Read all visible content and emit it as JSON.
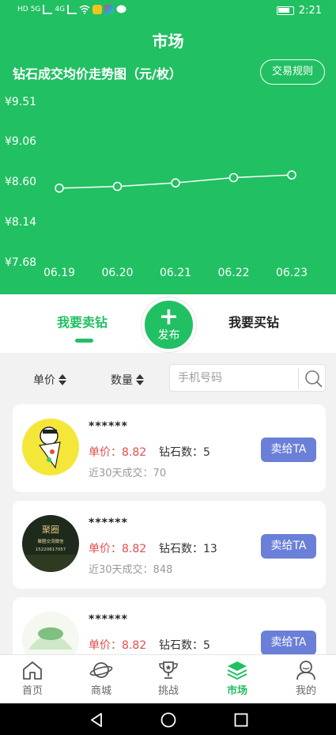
{
  "status_bar": {
    "time": "2:21",
    "left_labels": [
      "HD",
      "5G",
      "4G"
    ]
  },
  "header": {
    "title": "市场",
    "chart_title": "钻石成交均价走势图（元/枚）",
    "rules_button": "交易规则"
  },
  "chart_data": {
    "type": "line",
    "title": "钻石成交均价走势图（元/枚）",
    "categories": [
      "06.19",
      "06.20",
      "06.21",
      "06.22",
      "06.23"
    ],
    "series": [
      {
        "values": [
          8.52,
          8.54,
          8.58,
          8.64,
          8.67
        ]
      }
    ],
    "y_ticks": [
      "¥9.51",
      "¥9.06",
      "¥8.60",
      "¥8.14",
      "¥7.68"
    ],
    "y_tick_values": [
      9.51,
      9.06,
      8.6,
      8.14,
      7.68
    ],
    "ylim": [
      7.68,
      9.51
    ],
    "grid": false,
    "line_color": "#ffffff"
  },
  "tabs": {
    "sell": "我要卖钻",
    "buy": "我要买钻",
    "publish": "发布",
    "publish_symbol": "+"
  },
  "filter": {
    "sort_price": "单价",
    "sort_quantity": "数量",
    "search_placeholder": "手机号码"
  },
  "listings": [
    {
      "nickname": "******",
      "price_label": "单价：8.82",
      "count_label": "钻石数：5",
      "recent_label": "近30天成交：70",
      "action": "卖给TA"
    },
    {
      "nickname": "******",
      "price_label": "单价：8.82",
      "count_label": "钻石数：13",
      "recent_label": "近30天成交：848",
      "action": "卖给TA",
      "avatar_text": "聚圈",
      "avatar_subtext": "聚圈交流微信",
      "avatar_phone": "15220617057"
    },
    {
      "nickname": "******",
      "price_label": "单价：8.82",
      "count_label": "钻石数：5",
      "action": "卖给TA"
    }
  ],
  "bottom_nav": [
    {
      "label": "首页",
      "icon": "home-icon"
    },
    {
      "label": "商城",
      "icon": "planet-icon"
    },
    {
      "label": "挑战",
      "icon": "trophy-icon"
    },
    {
      "label": "市场",
      "icon": "layers-icon",
      "active": true
    },
    {
      "label": "我的",
      "icon": "user-icon"
    }
  ],
  "colors": {
    "brand_green": "#21c062",
    "price_red": "#e84c4c",
    "action_blue": "#6a7fd8"
  }
}
